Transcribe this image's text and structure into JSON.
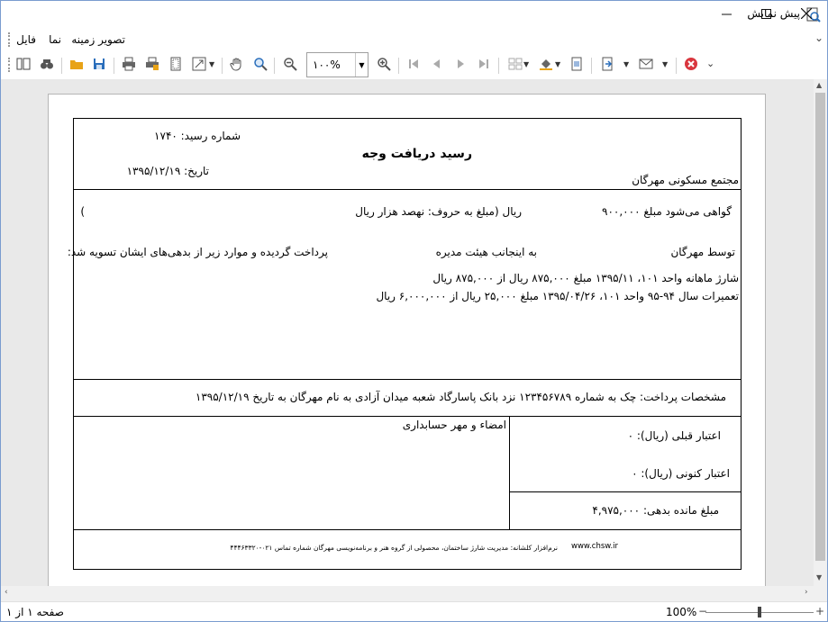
{
  "window": {
    "title": "پیش نمایش",
    "icons": {
      "app": "preview-icon",
      "minimize": "minimize-icon",
      "maximize": "maximize-icon",
      "close": "close-icon"
    }
  },
  "menu": {
    "items": [
      {
        "label": "فایل"
      },
      {
        "label": "نما"
      },
      {
        "label": "تصویر زمینه"
      }
    ]
  },
  "toolbar": {
    "zoom_value": "۱۰۰%",
    "icons": [
      "thumbnails-icon",
      "find-icon",
      "open-icon",
      "save-icon",
      "print-icon",
      "quick-print-icon",
      "page-setup-icon",
      "scale-icon",
      "hand-tool-icon",
      "magnifier-icon",
      "zoom-out-icon",
      "zoom-in-icon",
      "first-page-icon",
      "previous-page-icon",
      "next-page-icon",
      "last-page-icon",
      "multiple-pages-icon",
      "background-color-icon",
      "watermark-icon",
      "export-icon",
      "send-email-icon",
      "close-preview-icon"
    ],
    "accent_colors": {
      "close": "#d9363e",
      "folder": "#e8a317",
      "save": "#2a6ebb"
    }
  },
  "receipt": {
    "receipt_number": "شماره رسید: ۱۷۴۰",
    "title": "رسید دریافت وجه",
    "date": "تاریخ: ۱۳۹۵/۱۲/۱۹",
    "complex_name": "مجتمع مسکونی مهرگان",
    "certify_amount": "گواهی می‌شود مبلغ  ۹۰۰,۰۰۰",
    "rial_in_words": "ریال (مبلغ به حروف: نهصد هزار ریال",
    "close_paren": ")",
    "by_label": "توسط مهرگان",
    "undersigned": "به اینجانب  هیئت مدیره",
    "paid_text": "پرداخت گردیده و موارد زیر از بدهی‌های ایشان تسویه شد:",
    "line1": "شارژ ماهانه واحد ۱۰۱، ۱۳۹۵/۱۱ مبلغ ۸۷۵,۰۰۰ ریال از ۸۷۵,۰۰۰ ریال",
    "line2": "تعمیرات سال ۹۴-۹۵ واحد ۱۰۱، ۱۳۹۵/۰۴/۲۶ مبلغ ۲۵,۰۰۰ ریال از ۶,۰۰۰,۰۰۰ ریال",
    "payment_details": "مشخصات پرداخت: چک به شماره ۱۲۳۴۵۶۷۸۹ نزد بانک پاسارگاد شعبه میدان آزادی به نام مهرگان به تاریخ ۱۳۹۵/۱۲/۱۹",
    "signature": "امضاء و مهر حسابداری",
    "prev_credit": "اعتبار قبلی (ریال):  ۰",
    "current_credit": "اعتبار کنونی (ریال):  ۰",
    "remaining_debt": "مبلغ مانده بدهی:  ۴,۹۷۵,۰۰۰",
    "footer_software": "نرم‌افزار کلشانه: مدیریت شارژ ساختمان، محصولی از گروه هنر و برنامه‌نویسی مهرگان شماره تماس ۰۲۱-۴۴۴۶۳۳۲۰",
    "footer_url": "www.chsw.ir"
  },
  "statusbar": {
    "page_info": "صفحه ۱ از ۱",
    "zoom": "100%"
  }
}
